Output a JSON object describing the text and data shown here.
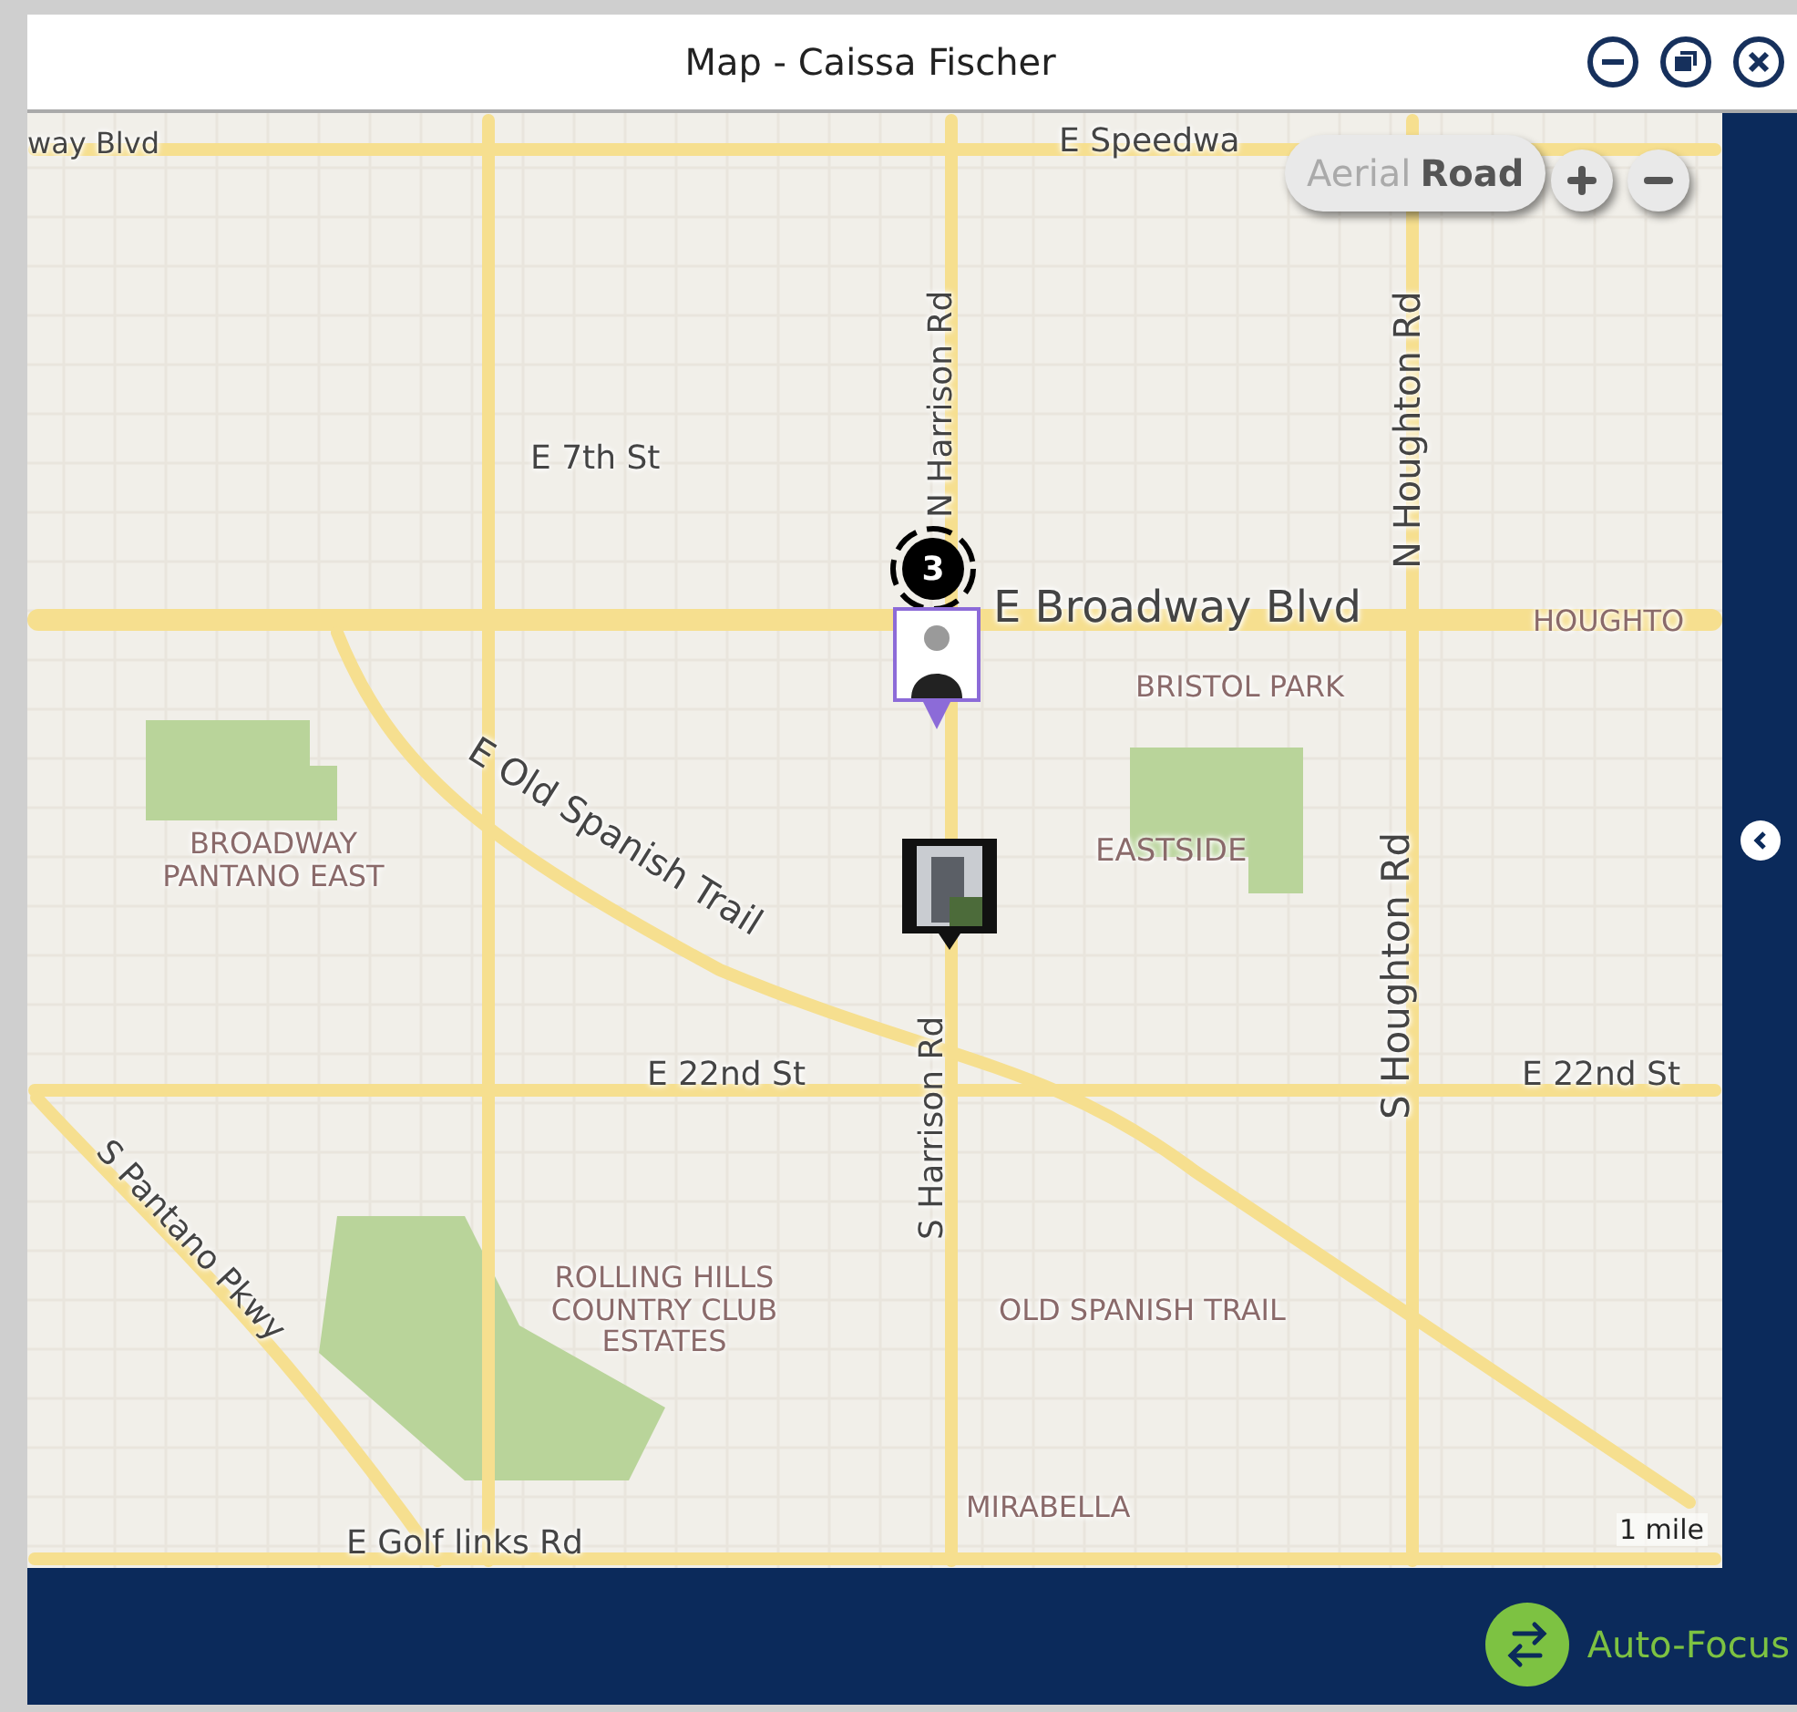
{
  "window": {
    "title": "Map - Caissa Fischer"
  },
  "map_type": [
    {
      "label": "Aerial",
      "selected": false
    },
    {
      "label": "Road",
      "selected": true
    }
  ],
  "map": {
    "labels": [
      {
        "text": "way Blvd",
        "kind": "street"
      },
      {
        "text": "E Speedwa",
        "kind": "street"
      },
      {
        "text": "N Harrison Rd",
        "kind": "street"
      },
      {
        "text": "E 7th St",
        "kind": "street"
      },
      {
        "text": "N Houghton Rd",
        "kind": "street"
      },
      {
        "text": "E Broadway Blvd",
        "kind": "street"
      },
      {
        "text": "HOUGHTO",
        "kind": "area"
      },
      {
        "text": "BRISTOL PARK",
        "kind": "area"
      },
      {
        "text": "BROADWAY PANTANO EAST",
        "kind": "area"
      },
      {
        "text": "E Old Spanish Trail",
        "kind": "street"
      },
      {
        "text": "EASTSIDE",
        "kind": "area"
      },
      {
        "text": "S Harrison Rd",
        "kind": "street"
      },
      {
        "text": "S Houghton Rd",
        "kind": "street"
      },
      {
        "text": "E 22nd St",
        "kind": "street"
      },
      {
        "text": "E 22nd St",
        "kind": "street"
      },
      {
        "text": "S Pantano Pkwy",
        "kind": "street"
      },
      {
        "text": "ROLLING HILLS COUNTRY CLUB ESTATES",
        "kind": "area"
      },
      {
        "text": "OLD SPANISH TRAIL",
        "kind": "area"
      },
      {
        "text": "MIRABELLA",
        "kind": "area"
      },
      {
        "text": "E Golf links Rd",
        "kind": "street"
      }
    ],
    "cluster": {
      "count": "3"
    },
    "pins": [
      {
        "kind": "person"
      },
      {
        "kind": "building"
      }
    ],
    "scale": "1 mile"
  },
  "side_panel": {
    "expanded": false
  },
  "auto_focus": {
    "label": "Auto-Focus"
  }
}
